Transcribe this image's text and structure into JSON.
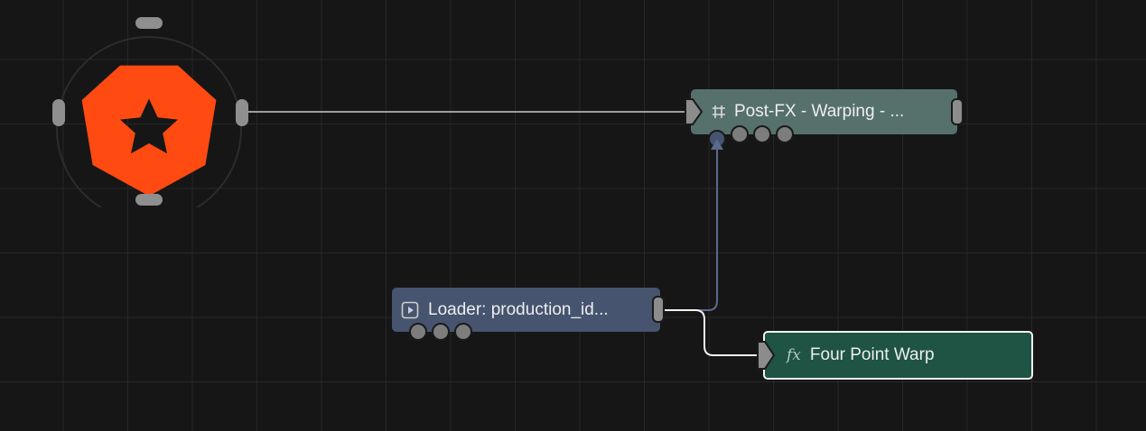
{
  "app": {
    "logo_name": "orange-gear-star-logo"
  },
  "nodes": {
    "postfx": {
      "label": "Post-FX - Warping - ...",
      "icon": "hash-icon"
    },
    "loader": {
      "label": "Loader: production_id...",
      "icon": "play-icon"
    },
    "warp": {
      "label": "Four Point Warp",
      "icon": "fx-icon",
      "icon_text": "fx",
      "selected": true
    }
  },
  "colors": {
    "canvas": "#161616",
    "grid": "#272727",
    "logo": "#ff4a12",
    "postfx_node": "#56706b",
    "loader_node": "#46546f",
    "warp_node": "#1f5344",
    "link_wire": "#9e9e9e",
    "blue_wire": "#5a6a8c",
    "selected_wire": "#f2f2f2",
    "port": "#8c8c8c"
  }
}
